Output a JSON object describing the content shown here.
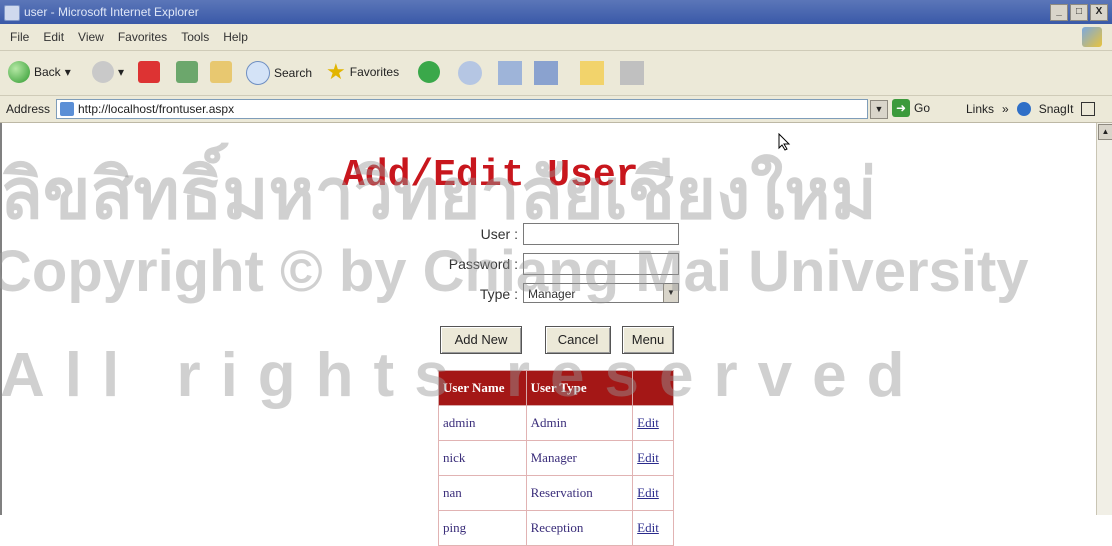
{
  "window": {
    "title": "user - Microsoft Internet Explorer",
    "controls": [
      "_",
      "□",
      "X"
    ]
  },
  "menu": {
    "items": [
      "File",
      "Edit",
      "View",
      "Favorites",
      "Tools",
      "Help"
    ]
  },
  "toolbar": {
    "back": "Back",
    "search": "Search",
    "favorites": "Favorites"
  },
  "address": {
    "label": "Address",
    "url": "http://localhost/frontuser.aspx",
    "go": "Go",
    "links": "Links",
    "links_more": "»",
    "snagit": "SnagIt"
  },
  "page": {
    "title": "Add/Edit User",
    "user_label": "User :",
    "password_label": "Password :",
    "type_label": "Type :",
    "type_value": "Manager",
    "buttons": {
      "add": "Add New",
      "cancel": "Cancel",
      "menu": "Menu"
    },
    "grid": {
      "headers": [
        "User Name",
        "User Type",
        ""
      ],
      "rows": [
        [
          "admin",
          "Admin",
          "Edit"
        ],
        [
          "nick",
          "Manager",
          "Edit"
        ],
        [
          "nan",
          "Reservation",
          "Edit"
        ],
        [
          "ping",
          "Reception",
          "Edit"
        ]
      ]
    }
  },
  "watermark": {
    "line1": "ลิขสิทธิ์มหาวิทยาลัยเชียงใหม่",
    "line2": "Copyright © by Chiang Mai University",
    "line3": "All rights reserved"
  },
  "colors": {
    "title_red": "#c8161d",
    "grid_header": "#a41716"
  }
}
